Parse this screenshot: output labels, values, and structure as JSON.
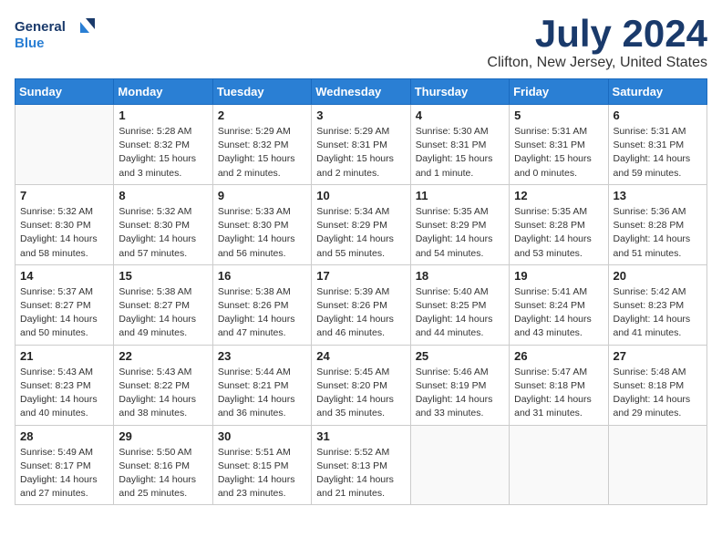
{
  "logo": {
    "line1": "General",
    "line2": "Blue"
  },
  "title": "July 2024",
  "location": "Clifton, New Jersey, United States",
  "weekdays": [
    "Sunday",
    "Monday",
    "Tuesday",
    "Wednesday",
    "Thursday",
    "Friday",
    "Saturday"
  ],
  "weeks": [
    [
      {
        "day": "",
        "info": ""
      },
      {
        "day": "1",
        "info": "Sunrise: 5:28 AM\nSunset: 8:32 PM\nDaylight: 15 hours\nand 3 minutes."
      },
      {
        "day": "2",
        "info": "Sunrise: 5:29 AM\nSunset: 8:32 PM\nDaylight: 15 hours\nand 2 minutes."
      },
      {
        "day": "3",
        "info": "Sunrise: 5:29 AM\nSunset: 8:31 PM\nDaylight: 15 hours\nand 2 minutes."
      },
      {
        "day": "4",
        "info": "Sunrise: 5:30 AM\nSunset: 8:31 PM\nDaylight: 15 hours\nand 1 minute."
      },
      {
        "day": "5",
        "info": "Sunrise: 5:31 AM\nSunset: 8:31 PM\nDaylight: 15 hours\nand 0 minutes."
      },
      {
        "day": "6",
        "info": "Sunrise: 5:31 AM\nSunset: 8:31 PM\nDaylight: 14 hours\nand 59 minutes."
      }
    ],
    [
      {
        "day": "7",
        "info": "Sunrise: 5:32 AM\nSunset: 8:30 PM\nDaylight: 14 hours\nand 58 minutes."
      },
      {
        "day": "8",
        "info": "Sunrise: 5:32 AM\nSunset: 8:30 PM\nDaylight: 14 hours\nand 57 minutes."
      },
      {
        "day": "9",
        "info": "Sunrise: 5:33 AM\nSunset: 8:30 PM\nDaylight: 14 hours\nand 56 minutes."
      },
      {
        "day": "10",
        "info": "Sunrise: 5:34 AM\nSunset: 8:29 PM\nDaylight: 14 hours\nand 55 minutes."
      },
      {
        "day": "11",
        "info": "Sunrise: 5:35 AM\nSunset: 8:29 PM\nDaylight: 14 hours\nand 54 minutes."
      },
      {
        "day": "12",
        "info": "Sunrise: 5:35 AM\nSunset: 8:28 PM\nDaylight: 14 hours\nand 53 minutes."
      },
      {
        "day": "13",
        "info": "Sunrise: 5:36 AM\nSunset: 8:28 PM\nDaylight: 14 hours\nand 51 minutes."
      }
    ],
    [
      {
        "day": "14",
        "info": "Sunrise: 5:37 AM\nSunset: 8:27 PM\nDaylight: 14 hours\nand 50 minutes."
      },
      {
        "day": "15",
        "info": "Sunrise: 5:38 AM\nSunset: 8:27 PM\nDaylight: 14 hours\nand 49 minutes."
      },
      {
        "day": "16",
        "info": "Sunrise: 5:38 AM\nSunset: 8:26 PM\nDaylight: 14 hours\nand 47 minutes."
      },
      {
        "day": "17",
        "info": "Sunrise: 5:39 AM\nSunset: 8:26 PM\nDaylight: 14 hours\nand 46 minutes."
      },
      {
        "day": "18",
        "info": "Sunrise: 5:40 AM\nSunset: 8:25 PM\nDaylight: 14 hours\nand 44 minutes."
      },
      {
        "day": "19",
        "info": "Sunrise: 5:41 AM\nSunset: 8:24 PM\nDaylight: 14 hours\nand 43 minutes."
      },
      {
        "day": "20",
        "info": "Sunrise: 5:42 AM\nSunset: 8:23 PM\nDaylight: 14 hours\nand 41 minutes."
      }
    ],
    [
      {
        "day": "21",
        "info": "Sunrise: 5:43 AM\nSunset: 8:23 PM\nDaylight: 14 hours\nand 40 minutes."
      },
      {
        "day": "22",
        "info": "Sunrise: 5:43 AM\nSunset: 8:22 PM\nDaylight: 14 hours\nand 38 minutes."
      },
      {
        "day": "23",
        "info": "Sunrise: 5:44 AM\nSunset: 8:21 PM\nDaylight: 14 hours\nand 36 minutes."
      },
      {
        "day": "24",
        "info": "Sunrise: 5:45 AM\nSunset: 8:20 PM\nDaylight: 14 hours\nand 35 minutes."
      },
      {
        "day": "25",
        "info": "Sunrise: 5:46 AM\nSunset: 8:19 PM\nDaylight: 14 hours\nand 33 minutes."
      },
      {
        "day": "26",
        "info": "Sunrise: 5:47 AM\nSunset: 8:18 PM\nDaylight: 14 hours\nand 31 minutes."
      },
      {
        "day": "27",
        "info": "Sunrise: 5:48 AM\nSunset: 8:18 PM\nDaylight: 14 hours\nand 29 minutes."
      }
    ],
    [
      {
        "day": "28",
        "info": "Sunrise: 5:49 AM\nSunset: 8:17 PM\nDaylight: 14 hours\nand 27 minutes."
      },
      {
        "day": "29",
        "info": "Sunrise: 5:50 AM\nSunset: 8:16 PM\nDaylight: 14 hours\nand 25 minutes."
      },
      {
        "day": "30",
        "info": "Sunrise: 5:51 AM\nSunset: 8:15 PM\nDaylight: 14 hours\nand 23 minutes."
      },
      {
        "day": "31",
        "info": "Sunrise: 5:52 AM\nSunset: 8:13 PM\nDaylight: 14 hours\nand 21 minutes."
      },
      {
        "day": "",
        "info": ""
      },
      {
        "day": "",
        "info": ""
      },
      {
        "day": "",
        "info": ""
      }
    ]
  ]
}
